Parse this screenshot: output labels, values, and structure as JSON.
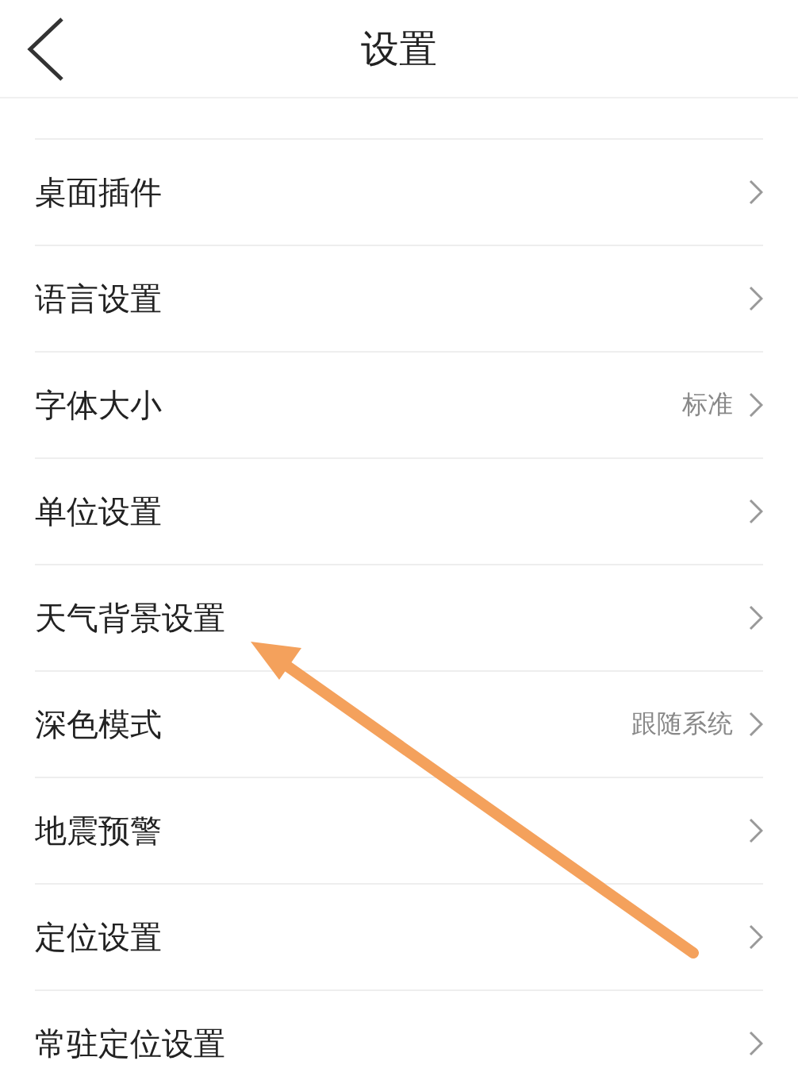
{
  "header": {
    "title": "设置"
  },
  "items": [
    {
      "label": "桌面插件"
    },
    {
      "label": "语言设置"
    },
    {
      "label": "字体大小",
      "value": "标准"
    },
    {
      "label": "单位设置"
    },
    {
      "label": "天气背景设置"
    },
    {
      "label": "深色模式",
      "value": "跟随系统"
    },
    {
      "label": "地震预警"
    },
    {
      "label": "定位设置"
    },
    {
      "label": "常驻定位设置"
    }
  ]
}
